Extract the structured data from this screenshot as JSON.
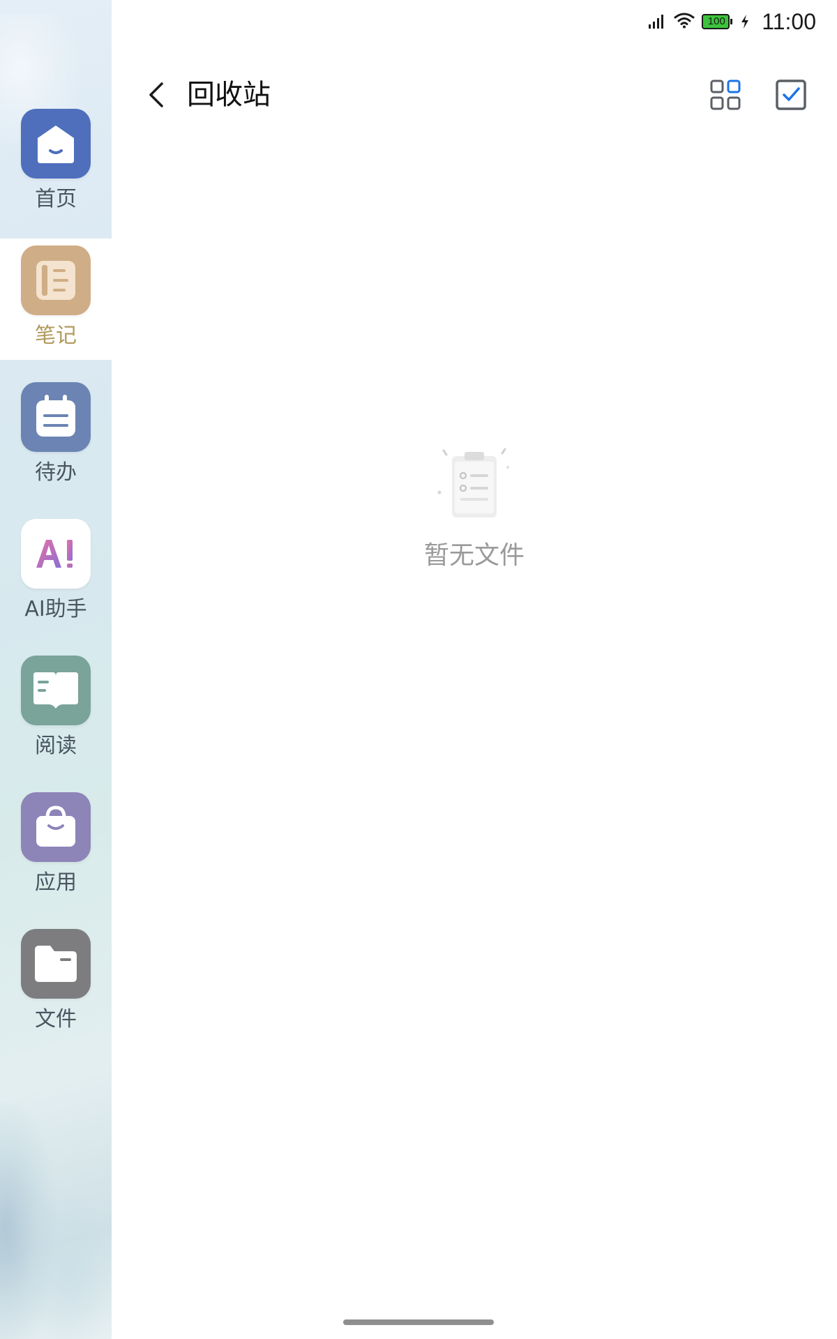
{
  "status_bar": {
    "time": "11:00",
    "battery": "100"
  },
  "header": {
    "title": "回收站"
  },
  "sidebar": {
    "items": [
      {
        "label": "首页",
        "icon": "home-icon",
        "color": "#4f6fbd"
      },
      {
        "label": "笔记",
        "icon": "notebook-icon",
        "color": "#cfad86"
      },
      {
        "label": "待办",
        "icon": "todo-icon",
        "color": "#6b84b3"
      },
      {
        "label": "AI助手",
        "icon": "ai-icon",
        "color": "#ffffff"
      },
      {
        "label": "阅读",
        "icon": "book-icon",
        "color": "#7aa39a"
      },
      {
        "label": "应用",
        "icon": "bag-icon",
        "color": "#8d84b8"
      },
      {
        "label": "文件",
        "icon": "folder-icon",
        "color": "#7d7d80"
      }
    ],
    "selected": "笔记"
  },
  "empty_state": {
    "text": "暂无文件",
    "icon": "empty-clipboard-icon"
  },
  "colors": {
    "accent": "#1a73e8",
    "selected_label": "#b09a5b"
  }
}
